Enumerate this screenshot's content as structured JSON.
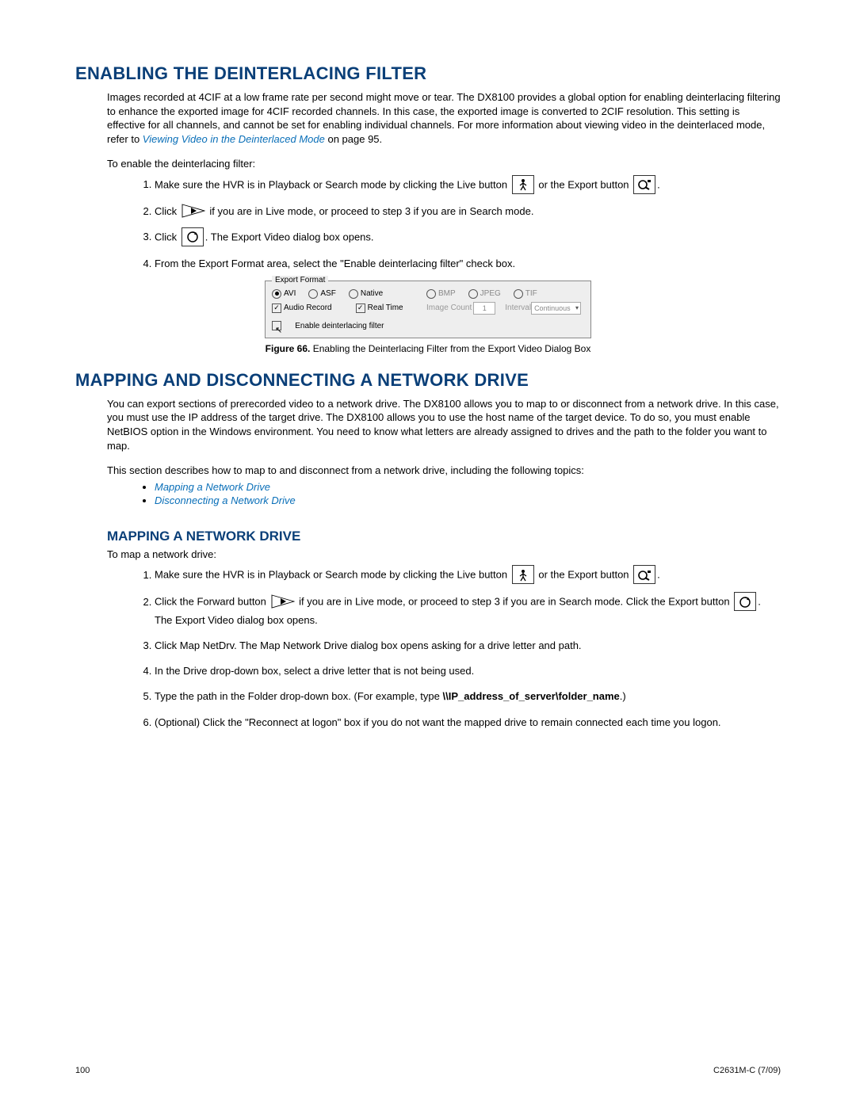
{
  "section1": {
    "title": "Enabling the Deinterlacing Filter",
    "para1a": "Images recorded at 4CIF at a low frame rate per second might move or tear. The DX8100 provides a global option for enabling deinterlacing filtering to enhance the exported image for 4CIF recorded channels. In this case, the exported image is converted to 2CIF resolution. This setting is effective for all channels, and cannot be set for enabling individual channels. For more information about viewing video in the deinterlaced mode, refer to ",
    "para1_link": "Viewing Video in the Deinterlaced Mode",
    "para1b": " on page 95.",
    "para2": "To enable the deinterlacing filter:",
    "steps": {
      "s1a": "Make sure the HVR is in Playback or Search mode by clicking the Live button",
      "s1b": "or the Export button",
      "s2a": "Click",
      "s2b": "if you are in Live mode, or proceed to step 3 if you are in Search mode.",
      "s3a": "Click",
      "s3b": ". The Export Video dialog box opens.",
      "s4": "From the Export Format area, select the \"Enable deinterlacing filter\" check box."
    },
    "figure": {
      "legend": "Export Format",
      "avi": "AVI",
      "asf": "ASF",
      "native": "Native",
      "bmp": "BMP",
      "jpeg": "JPEG",
      "tif": "TIF",
      "audio": "Audio Record",
      "realtime": "Real Time",
      "imgcount_lbl": "Image Count",
      "imgcount_val": "1",
      "interval_lbl": "Interval",
      "interval_val": "Continuous",
      "enable": "Enable deinterlacing filter",
      "caption_b": "Figure 66.",
      "caption": "  Enabling the Deinterlacing Filter from the Export Video Dialog Box"
    }
  },
  "section2": {
    "title": "Mapping and Disconnecting a Network Drive",
    "para1": "You can export sections of prerecorded video to a network drive. The DX8100 allows you to map to or disconnect from a network drive. In this case, you must use the IP address of the target drive. The DX8100 allows you to use the host name of the target device. To do so, you must enable NetBIOS option in the Windows environment. You need to know what letters are already assigned to drives and the path to the folder you want to map.",
    "para2": "This section describes how to map to and disconnect from a network drive, including the following topics:",
    "bullets": {
      "b1": "Mapping a Network Drive",
      "b2": "Disconnecting a Network Drive"
    }
  },
  "section3": {
    "title": "Mapping a Network Drive",
    "lead": "To map a network drive:",
    "steps": {
      "s1a": "Make sure the HVR is in Playback or Search mode by clicking the Live button",
      "s1b": "or the Export button",
      "s2a": "Click the Forward button",
      "s2b": "if you are in Live mode, or proceed to step 3 if you are in Search mode. Click the Export button",
      "s2c": ". The Export Video dialog box opens.",
      "s3": "Click Map NetDrv. The Map Network Drive dialog box opens asking for a drive letter and path.",
      "s4": "In the Drive drop-down box, select a drive letter that is not being used.",
      "s5a": "Type the path in the Folder drop-down box. (For example, type ",
      "s5b": "\\\\IP_address_of_server\\folder_name",
      "s5c": ".)",
      "s6": "(Optional) Click the \"Reconnect at logon\" box if you do not want the mapped drive to remain connected each time you logon."
    }
  },
  "footer": {
    "page": "100",
    "doc": "C2631M-C (7/09)"
  }
}
